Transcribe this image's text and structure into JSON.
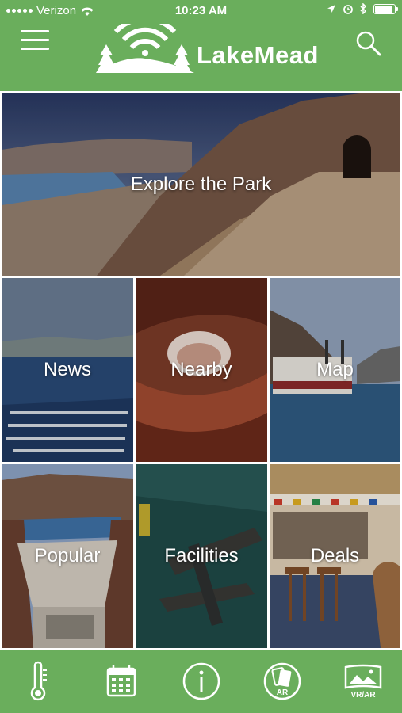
{
  "status_bar": {
    "carrier": "Verizon",
    "time": "10:23 AM"
  },
  "header": {
    "app_name": "LakeMead",
    "menu_icon": "hamburger-menu-icon",
    "search_icon": "search-icon",
    "brand_color": "#6aae5c"
  },
  "hero": {
    "label": "Explore the Park"
  },
  "grid": {
    "news": "News",
    "nearby": "Nearby",
    "map": "Map",
    "popular": "Popular",
    "facilities": "Facilities",
    "deals": "Deals"
  },
  "tabs": {
    "weather_icon": "thermometer-icon",
    "events_icon": "calendar-icon",
    "info_icon": "info-icon",
    "ar_label": "AR",
    "vrar_label": "VR/AR"
  }
}
